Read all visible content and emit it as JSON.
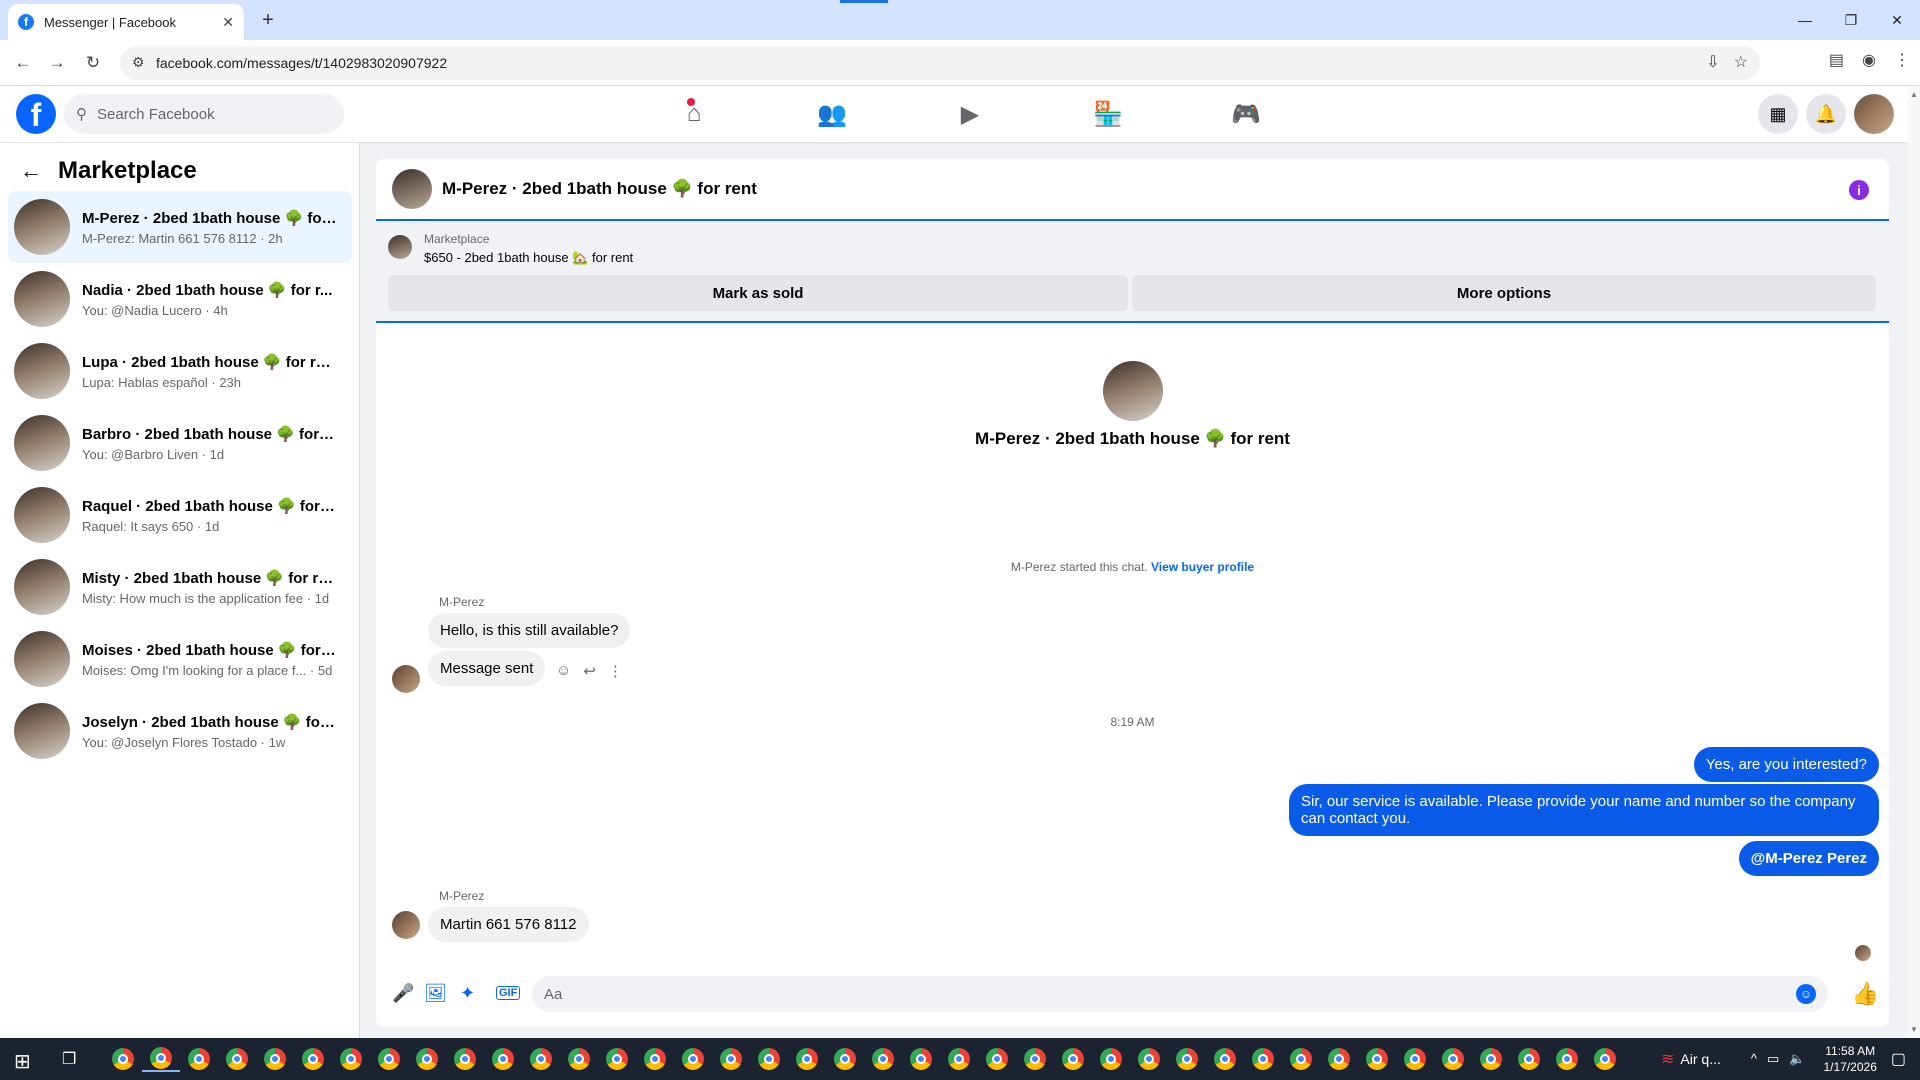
{
  "browser": {
    "tab_title": "Messenger | Facebook",
    "tab_favicon": "f",
    "tab_close": "✕",
    "new_tab": "+",
    "url": "facebook.com/messages/t/1402983020907922",
    "win_controls": [
      "—",
      "❐",
      "✕"
    ]
  },
  "fb": {
    "logo": "f",
    "search_placeholder": "Search Facebook",
    "nav": [
      {
        "icon": "home-icon",
        "glyph": "⌂",
        "notification": true
      },
      {
        "icon": "friends-icon",
        "glyph": "👥",
        "notification": false
      },
      {
        "icon": "video-icon",
        "glyph": "▶",
        "notification": false
      },
      {
        "icon": "marketplace-icon",
        "glyph": "🏪",
        "notification": false
      },
      {
        "icon": "gaming-icon",
        "glyph": "🎮",
        "notification": false
      }
    ],
    "menu_glyph": "⋮⋮⋮",
    "bell_glyph": "🔔"
  },
  "sidebar": {
    "title": "Marketplace",
    "back_glyph": "←",
    "conversations": [
      {
        "name": "M-Perez · 2bed 1bath house 🌳 for...",
        "preview": "M-Perez: Martin 661 576 8112 · 2h",
        "active": true
      },
      {
        "name": "Nadia · 2bed 1bath house 🌳 for r...",
        "preview": "You: @Nadia Lucero · 4h",
        "active": false
      },
      {
        "name": "Lupa · 2bed 1bath house 🌳 for rent",
        "preview": "Lupa: Hablas español · 23h",
        "active": false
      },
      {
        "name": "Barbro · 2bed 1bath house 🌳 for r...",
        "preview": "You: @Barbro Liven · 1d",
        "active": false
      },
      {
        "name": "Raquel · 2bed 1bath house 🌳 for r...",
        "preview": "Raquel: It says 650 · 1d",
        "active": false
      },
      {
        "name": "Misty · 2bed 1bath house 🌳 for rent",
        "preview": "Misty: How much is the application fee · 1d",
        "active": false
      },
      {
        "name": "Moises · 2bed 1bath house 🌳 for r...",
        "preview": "Moises: Omg I'm looking for a place f... · 5d",
        "active": false
      },
      {
        "name": "Joselyn · 2bed 1bath house 🌳 for ...",
        "preview": "You: @Joselyn Flores Tostado · 1w",
        "active": false
      }
    ]
  },
  "chat": {
    "title": "M-Perez · 2bed 1bath house 🌳 for rent",
    "info_glyph": "i",
    "listing": {
      "source": "Marketplace",
      "price_title": "$650 - 2bed 1bath house 🏡 for rent",
      "mark_sold": "Mark as sold",
      "more_options": "More options"
    },
    "intro_title": "M-Perez · 2bed 1bath house 🌳 for rent",
    "started_text": "M-Perez started this chat.",
    "view_buyer_profile": "View buyer profile",
    "sender_name": "M-Perez",
    "incoming_1": "Hello, is this still available?",
    "incoming_2": "Message sent",
    "message_actions": [
      "☺",
      "↩",
      "⋮"
    ],
    "timestamp": "8:19 AM",
    "outgoing": [
      "Yes, are you interested?",
      "Sir, our service is available. Please provide your name and number so the company can contact you.",
      "@M-Perez Perez"
    ],
    "sender_name_2": "M-Perez",
    "incoming_3": "Martin 661 576 8112",
    "composer_placeholder": "Aa",
    "gif_label": "GIF"
  },
  "taskbar": {
    "weather": "Air q...",
    "time": "11:58 AM",
    "date": "1/17/2026",
    "app_count": 40
  },
  "colors": {
    "accent": "#0866ff",
    "outgoing_bubble": "#0a5ce8",
    "active_conv": "#ebf5ff"
  }
}
